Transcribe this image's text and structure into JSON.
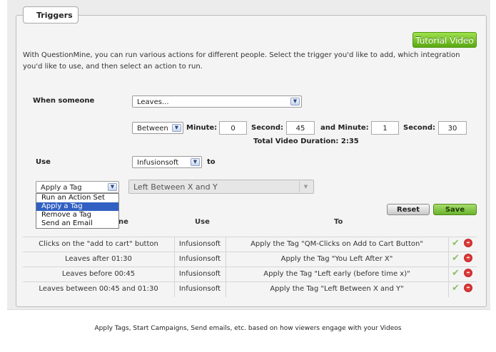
{
  "tab_title": "Triggers",
  "tutorial_button": "Tutorial Video",
  "intro_text": "With QuestionMine, you can run various actions for different people. Select the trigger you'd like to add, which integration you'd like to use, and then select an action to run.",
  "when_label": "When someone",
  "when_value": "Leaves...",
  "range_value": "Between",
  "minute_label": "Minute:",
  "second_label": "Second:",
  "and_minute_label": "and  Minute:",
  "start_minute": "0",
  "start_second": "45",
  "end_minute": "1",
  "end_second": "30",
  "duration_text": "Total Video Duration: 2:35",
  "use_label": "Use",
  "integration_value": "Infusionsoft",
  "to_label": "to",
  "action_value": "Apply a Tag",
  "tag_value": "Left Between X and Y",
  "action_options": [
    "Run an Action Set",
    "Apply a Tag",
    "Remove a Tag",
    "Send an Email"
  ],
  "reset_label": "Reset",
  "save_label": "Save",
  "headers": {
    "trigger_partial": "ne",
    "use": "Use",
    "to": "To"
  },
  "rows": [
    {
      "trigger": "Clicks on the \"add to cart\" button",
      "use": "Infusionsoft",
      "to": "Apply the Tag \"QM-Clicks on Add to Cart Button\""
    },
    {
      "trigger": "Leaves after 01:30",
      "use": "Infusionsoft",
      "to": "Apply the Tag \"You Left After X\""
    },
    {
      "trigger": "Leaves before 00:45",
      "use": "Infusionsoft",
      "to": "Apply the Tag \"Left early (before time x)\""
    },
    {
      "trigger": "Leaves between 00:45 and 01:30",
      "use": "Infusionsoft",
      "to": "Apply the Tag \"Left Between X and Y\""
    }
  ],
  "icons": {
    "edit": "check-icon",
    "delete": "delete-icon",
    "dropdown": "chevron-down-icon"
  },
  "colors": {
    "accent_green": "#6ab22e",
    "selected_blue": "#3160c2",
    "delete_red": "#c81818"
  },
  "caption": "Apply Tags, Start Campaigns, Send emails, etc. based on how viewers engage with your Videos"
}
